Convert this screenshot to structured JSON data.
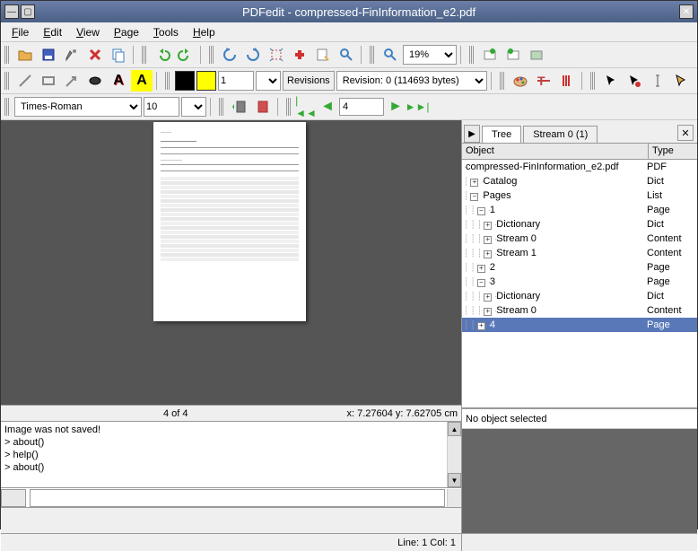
{
  "title": "PDFedit - compressed-FinInformation_e2.pdf",
  "menu": {
    "file": "File",
    "edit": "Edit",
    "view": "View",
    "page": "Page",
    "tools": "Tools",
    "help": "Help"
  },
  "toolbar2": {
    "zoom": "19%",
    "line_width": "1",
    "revisions_label": "Revisions",
    "revision": "Revision: 0 (114693 bytes)"
  },
  "toolbar3": {
    "font": "Times-Roman",
    "font_size": "10",
    "page": "4"
  },
  "status": {
    "page_of": "4 of 4",
    "coords": "x: 7.27604 y: 7.62705 cm"
  },
  "console": {
    "l1": "Image was not saved!",
    "l2": "> about()",
    "l3": "> help()",
    "l4": "> about()"
  },
  "bottom_status": "Line: 1 Col: 1",
  "tabs": {
    "tree": "Tree",
    "stream": "Stream 0 (1)"
  },
  "tree_headers": {
    "object": "Object",
    "type": "Type"
  },
  "tree": [
    {
      "indent": 0,
      "exp": "",
      "label": "compressed-FinInformation_e2.pdf",
      "type": "PDF"
    },
    {
      "indent": 1,
      "exp": "+",
      "label": "Catalog",
      "type": "Dict"
    },
    {
      "indent": 1,
      "exp": "-",
      "label": "Pages",
      "type": "List"
    },
    {
      "indent": 2,
      "exp": "-",
      "label": "1",
      "type": "Page"
    },
    {
      "indent": 3,
      "exp": "+",
      "label": "Dictionary",
      "type": "Dict"
    },
    {
      "indent": 3,
      "exp": "+",
      "label": "Stream 0",
      "type": "Content"
    },
    {
      "indent": 3,
      "exp": "+",
      "label": "Stream 1",
      "type": "Content"
    },
    {
      "indent": 2,
      "exp": "+",
      "label": "2",
      "type": "Page"
    },
    {
      "indent": 2,
      "exp": "-",
      "label": "3",
      "type": "Page"
    },
    {
      "indent": 3,
      "exp": "+",
      "label": "Dictionary",
      "type": "Dict"
    },
    {
      "indent": 3,
      "exp": "+",
      "label": "Stream 0",
      "type": "Content"
    },
    {
      "indent": 2,
      "exp": "+",
      "label": "4",
      "type": "Page",
      "selected": true
    }
  ],
  "properties": {
    "none": "No object selected"
  },
  "colors": {
    "black": "#000000",
    "yellow": "#ffff00"
  }
}
